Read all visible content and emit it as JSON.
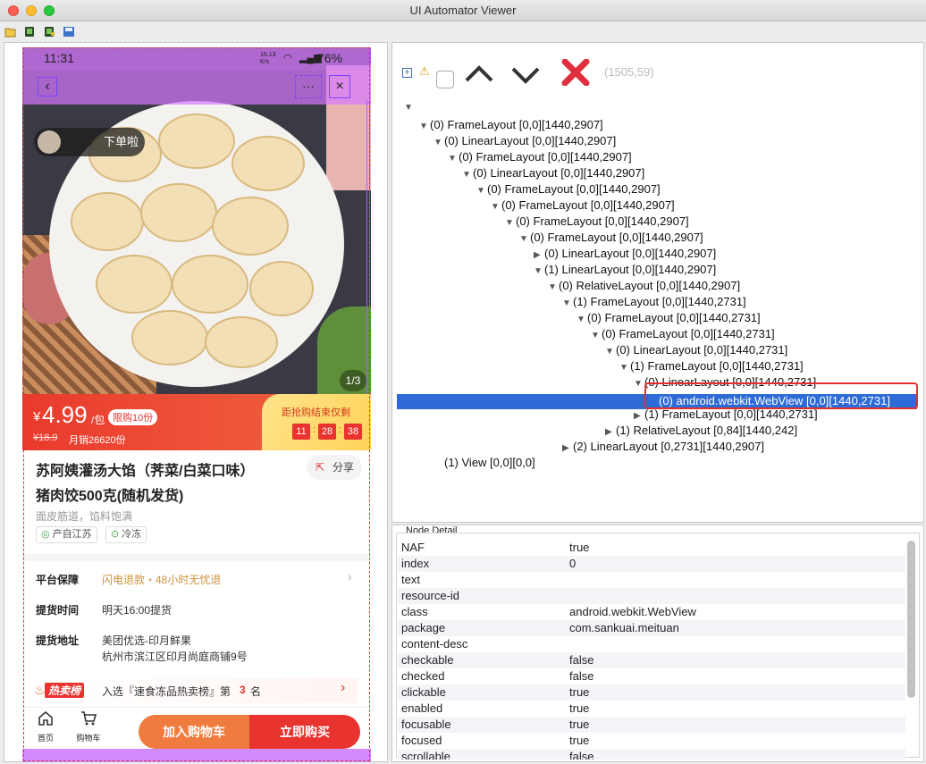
{
  "window": {
    "title": "UI Automator Viewer"
  },
  "toolbar": {
    "icons": [
      "open-folder-icon",
      "device-screenshot-icon",
      "device-screenshot-compressed-icon",
      "save-icon"
    ]
  },
  "tree_toolbar": {
    "coords": "(1505,59)"
  },
  "tree": [
    {
      "label": "(0) FrameLayout [0,0][1440,2907]",
      "expanded": true,
      "selected": false
    },
    {
      "label": "(0) LinearLayout [0,0][1440,2907]",
      "expanded": true,
      "selected": false
    },
    {
      "label": "(0) FrameLayout [0,0][1440,2907]",
      "expanded": true,
      "selected": false
    },
    {
      "label": "(0) LinearLayout [0,0][1440,2907]",
      "expanded": true,
      "selected": false
    },
    {
      "label": "(0) FrameLayout [0,0][1440,2907]",
      "expanded": true,
      "selected": false
    },
    {
      "label": "(0) FrameLayout [0,0][1440,2907]",
      "expanded": true,
      "selected": false
    },
    {
      "label": "(0) FrameLayout [0,0][1440,2907]",
      "expanded": true,
      "selected": false
    },
    {
      "label": "(0) FrameLayout [0,0][1440,2907]",
      "expanded": true,
      "selected": false
    },
    {
      "label": "(0) LinearLayout [0,0][1440,2907]",
      "expanded": false,
      "selected": false
    },
    {
      "label": "(1) LinearLayout [0,0][1440,2907]",
      "expanded": true,
      "selected": false
    },
    {
      "label": "(0) RelativeLayout [0,0][1440,2907]",
      "expanded": true,
      "selected": false
    },
    {
      "label": "(1) FrameLayout [0,0][1440,2731]",
      "expanded": true,
      "selected": false
    },
    {
      "label": "(0) FrameLayout [0,0][1440,2731]",
      "expanded": true,
      "selected": false
    },
    {
      "label": "(0) FrameLayout [0,0][1440,2731]",
      "expanded": true,
      "selected": false
    },
    {
      "label": "(0) LinearLayout [0,0][1440,2731]",
      "expanded": true,
      "selected": false
    },
    {
      "label": "(1) FrameLayout [0,0][1440,2731]",
      "expanded": true,
      "selected": false
    },
    {
      "label": "(0) LinearLayout [0,0][1440,2731]",
      "expanded": true,
      "selected": false
    },
    {
      "label": "(0) android.webkit.WebView [0,0][1440,2731]",
      "expanded": null,
      "selected": true
    },
    {
      "label": "(1) FrameLayout [0,0][1440,2731]",
      "expanded": false,
      "selected": false
    },
    {
      "label": "(1) RelativeLayout [0,84][1440,242]",
      "expanded": false,
      "selected": false
    },
    {
      "label": "(2) LinearLayout [0,2731][1440,2907]",
      "expanded": false,
      "selected": false
    },
    {
      "label": "(1) View [0,0][0,0]",
      "expanded": null,
      "selected": false
    }
  ],
  "node_detail": {
    "title": "Node Detail",
    "rows": [
      {
        "key": "NAF",
        "value": "true"
      },
      {
        "key": "index",
        "value": "0"
      },
      {
        "key": "text",
        "value": ""
      },
      {
        "key": "resource-id",
        "value": ""
      },
      {
        "key": "class",
        "value": "android.webkit.WebView"
      },
      {
        "key": "package",
        "value": "com.sankuai.meituan"
      },
      {
        "key": "content-desc",
        "value": ""
      },
      {
        "key": "checkable",
        "value": "false"
      },
      {
        "key": "checked",
        "value": "false"
      },
      {
        "key": "clickable",
        "value": "true"
      },
      {
        "key": "enabled",
        "value": "true"
      },
      {
        "key": "focusable",
        "value": "true"
      },
      {
        "key": "focused",
        "value": "true"
      },
      {
        "key": "scrollable",
        "value": "false"
      }
    ]
  },
  "phone": {
    "status": {
      "time": "11:31",
      "speed": "16.13 K/s",
      "battery": "76%"
    },
    "badge_text": "下单啦",
    "image_counter": "1/3",
    "price": {
      "currency": "¥",
      "amount": "4.99",
      "unit": "/包",
      "limit": "限购10份",
      "original": "¥18.9",
      "monthly": "月销26620份"
    },
    "countdown": {
      "label": "距抢购结束仅剩",
      "h": "11",
      "m": "28",
      "s": "38"
    },
    "product": {
      "title_line1": "苏阿姨灌汤大馅（荠菜/白菜口味）",
      "title_line2": "猪肉饺500克(随机发货)",
      "share": "分享",
      "subtitle": "面皮筋道，馅料饱满",
      "tag1": "产自江苏",
      "tag2": "冷冻"
    },
    "info": [
      {
        "label": "平台保障",
        "value": "闪电退款・48小时无忧退"
      },
      {
        "label": "提货时间",
        "value": "明天16:00提货"
      },
      {
        "label": "提货地址",
        "value": "美团优选-印月鲜果",
        "value2": "杭州市滨江区印月尚庭商铺9号"
      }
    ],
    "rank": {
      "badge": "热卖榜",
      "text_prefix": "入选『速食冻品热卖榜』第",
      "rank_num": "3",
      "text_suffix": "名"
    },
    "bottom": {
      "home": "首页",
      "cart": "购物车",
      "add_cart": "加入购物车",
      "buy_now": "立即购买"
    }
  },
  "colors": {
    "accent_red": "#e8332f",
    "orange": "#f07b3f",
    "selection": "#2f6bd6",
    "highlight_box": "#e0302c",
    "overlay": "#c24bff"
  }
}
